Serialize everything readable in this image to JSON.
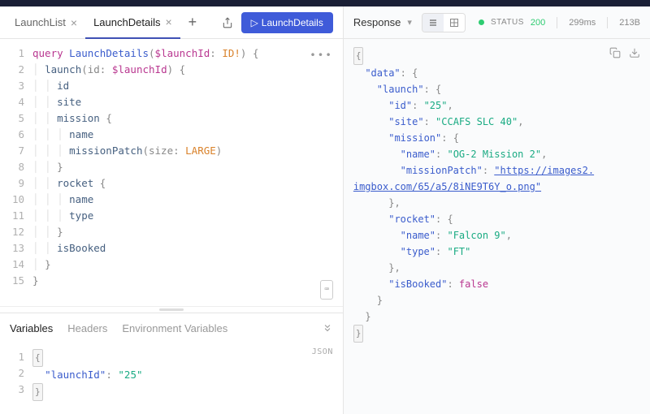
{
  "tabs": [
    {
      "label": "LaunchList"
    },
    {
      "label": "LaunchDetails",
      "active": true
    }
  ],
  "run_button_label": "LaunchDetails",
  "query_lines": [
    [
      {
        "t": "kw",
        "v": "query"
      },
      {
        "t": "sp",
        "v": " "
      },
      {
        "t": "name",
        "v": "LaunchDetails"
      },
      {
        "t": "punc",
        "v": "("
      },
      {
        "t": "var",
        "v": "$launchId"
      },
      {
        "t": "punc",
        "v": ": "
      },
      {
        "t": "type",
        "v": "ID!"
      },
      {
        "t": "punc",
        "v": ") {"
      }
    ],
    [
      {
        "t": "guide",
        "v": "│ "
      },
      {
        "t": "field",
        "v": "launch"
      },
      {
        "t": "punc",
        "v": "(id: "
      },
      {
        "t": "var",
        "v": "$launchId"
      },
      {
        "t": "punc",
        "v": ") {"
      }
    ],
    [
      {
        "t": "guide",
        "v": "│ │ "
      },
      {
        "t": "field",
        "v": "id"
      }
    ],
    [
      {
        "t": "guide",
        "v": "│ │ "
      },
      {
        "t": "field",
        "v": "site"
      }
    ],
    [
      {
        "t": "guide",
        "v": "│ │ "
      },
      {
        "t": "field",
        "v": "mission"
      },
      {
        "t": "punc",
        "v": " {"
      }
    ],
    [
      {
        "t": "guide",
        "v": "│ │ │ "
      },
      {
        "t": "field",
        "v": "name"
      }
    ],
    [
      {
        "t": "guide",
        "v": "│ │ │ "
      },
      {
        "t": "field",
        "v": "missionPatch"
      },
      {
        "t": "punc",
        "v": "(size: "
      },
      {
        "t": "enum",
        "v": "LARGE"
      },
      {
        "t": "punc",
        "v": ")"
      }
    ],
    [
      {
        "t": "guide",
        "v": "│ │ "
      },
      {
        "t": "punc",
        "v": "}"
      }
    ],
    [
      {
        "t": "guide",
        "v": "│ │ "
      },
      {
        "t": "field",
        "v": "rocket"
      },
      {
        "t": "punc",
        "v": " {"
      }
    ],
    [
      {
        "t": "guide",
        "v": "│ │ │ "
      },
      {
        "t": "field",
        "v": "name"
      }
    ],
    [
      {
        "t": "guide",
        "v": "│ │ │ "
      },
      {
        "t": "field",
        "v": "type"
      }
    ],
    [
      {
        "t": "guide",
        "v": "│ │ "
      },
      {
        "t": "punc",
        "v": "}"
      }
    ],
    [
      {
        "t": "guide",
        "v": "│ │ "
      },
      {
        "t": "field",
        "v": "isBooked"
      }
    ],
    [
      {
        "t": "guide",
        "v": "│ "
      },
      {
        "t": "punc",
        "v": "}"
      }
    ],
    [
      {
        "t": "punc",
        "v": "}"
      }
    ]
  ],
  "vars_tabs": {
    "variables": "Variables",
    "headers": "Headers",
    "env": "Environment Variables"
  },
  "vars_json_label": "JSON",
  "vars_lines": [
    [
      {
        "t": "brace",
        "v": "{"
      }
    ],
    [
      {
        "t": "sp",
        "v": "  "
      },
      {
        "t": "jkey",
        "v": "\"launchId\""
      },
      {
        "t": "punc",
        "v": ": "
      },
      {
        "t": "jstr",
        "v": "\"25\""
      }
    ],
    [
      {
        "t": "brace",
        "v": "}"
      }
    ]
  ],
  "response": {
    "title": "Response",
    "status_label": "STATUS",
    "status_code": "200",
    "time": "299ms",
    "size": "213B",
    "lines": [
      [
        {
          "t": "brace",
          "v": "{"
        }
      ],
      [
        {
          "t": "sp",
          "v": "  "
        },
        {
          "t": "jkey",
          "v": "\"data\""
        },
        {
          "t": "punc",
          "v": ": {"
        }
      ],
      [
        {
          "t": "sp",
          "v": "    "
        },
        {
          "t": "jkey",
          "v": "\"launch\""
        },
        {
          "t": "punc",
          "v": ": {"
        }
      ],
      [
        {
          "t": "sp",
          "v": "      "
        },
        {
          "t": "jkey",
          "v": "\"id\""
        },
        {
          "t": "punc",
          "v": ": "
        },
        {
          "t": "jstr",
          "v": "\"25\""
        },
        {
          "t": "punc",
          "v": ","
        }
      ],
      [
        {
          "t": "sp",
          "v": "      "
        },
        {
          "t": "jkey",
          "v": "\"site\""
        },
        {
          "t": "punc",
          "v": ": "
        },
        {
          "t": "jstr",
          "v": "\"CCAFS SLC 40\""
        },
        {
          "t": "punc",
          "v": ","
        }
      ],
      [
        {
          "t": "sp",
          "v": "      "
        },
        {
          "t": "jkey",
          "v": "\"mission\""
        },
        {
          "t": "punc",
          "v": ": {"
        }
      ],
      [
        {
          "t": "sp",
          "v": "        "
        },
        {
          "t": "jkey",
          "v": "\"name\""
        },
        {
          "t": "punc",
          "v": ": "
        },
        {
          "t": "jstr",
          "v": "\"OG-2 Mission 2\""
        },
        {
          "t": "punc",
          "v": ","
        }
      ],
      [
        {
          "t": "sp",
          "v": "        "
        },
        {
          "t": "jkey",
          "v": "\"missionPatch\""
        },
        {
          "t": "punc",
          "v": ": "
        },
        {
          "t": "jlink",
          "v": "\"https://images2."
        }
      ],
      [
        {
          "t": "jlink",
          "v": "imgbox.com/65/a5/8iNE9T6Y_o.png\""
        }
      ],
      [
        {
          "t": "sp",
          "v": "      "
        },
        {
          "t": "punc",
          "v": "},"
        }
      ],
      [
        {
          "t": "sp",
          "v": "      "
        },
        {
          "t": "jkey",
          "v": "\"rocket\""
        },
        {
          "t": "punc",
          "v": ": {"
        }
      ],
      [
        {
          "t": "sp",
          "v": "        "
        },
        {
          "t": "jkey",
          "v": "\"name\""
        },
        {
          "t": "punc",
          "v": ": "
        },
        {
          "t": "jstr",
          "v": "\"Falcon 9\""
        },
        {
          "t": "punc",
          "v": ","
        }
      ],
      [
        {
          "t": "sp",
          "v": "        "
        },
        {
          "t": "jkey",
          "v": "\"type\""
        },
        {
          "t": "punc",
          "v": ": "
        },
        {
          "t": "jstr",
          "v": "\"FT\""
        }
      ],
      [
        {
          "t": "sp",
          "v": "      "
        },
        {
          "t": "punc",
          "v": "},"
        }
      ],
      [
        {
          "t": "sp",
          "v": "      "
        },
        {
          "t": "jkey",
          "v": "\"isBooked\""
        },
        {
          "t": "punc",
          "v": ": "
        },
        {
          "t": "jbool",
          "v": "false"
        }
      ],
      [
        {
          "t": "sp",
          "v": "    "
        },
        {
          "t": "punc",
          "v": "}"
        }
      ],
      [
        {
          "t": "sp",
          "v": "  "
        },
        {
          "t": "punc",
          "v": "}"
        }
      ],
      [
        {
          "t": "brace",
          "v": "}"
        }
      ]
    ]
  }
}
